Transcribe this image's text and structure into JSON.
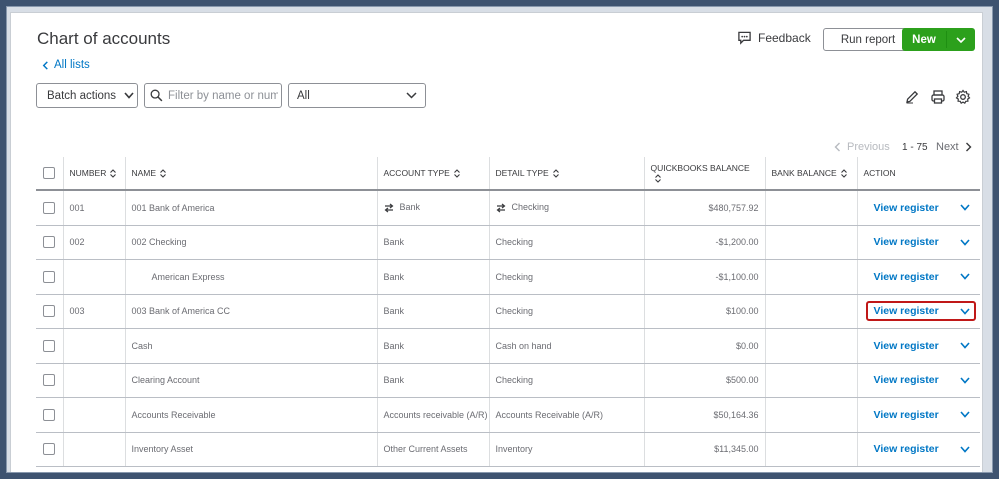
{
  "header": {
    "title": "Chart of accounts",
    "back_link": "All lists",
    "feedback": "Feedback",
    "run_report": "Run report",
    "new_label": "New"
  },
  "toolbar": {
    "batch_actions": "Batch actions",
    "search_placeholder": "Filter by name or number",
    "filter_value": "All"
  },
  "pager": {
    "previous": "Previous",
    "range": "1 - 75",
    "next": "Next"
  },
  "columns": {
    "number": "NUMBER",
    "name": "NAME",
    "account_type": "ACCOUNT TYPE",
    "detail_type": "DETAIL TYPE",
    "qb_balance": "QUICKBOOKS BALANCE",
    "bank_balance": "BANK BALANCE",
    "action": "ACTION"
  },
  "rows": [
    {
      "number": "001",
      "name": "001 Bank of America",
      "account_type": "Bank",
      "detail_type": "Checking",
      "qb_balance": "$480,757.92",
      "bank_balance": "",
      "action": "View register"
    },
    {
      "number": "002",
      "name": "002 Checking",
      "account_type": "Bank",
      "detail_type": "Checking",
      "qb_balance": "-$1,200.00",
      "bank_balance": "",
      "action": "View register"
    },
    {
      "number": "",
      "name": "American Express",
      "account_type": "Bank",
      "detail_type": "Checking",
      "qb_balance": "-$1,100.00",
      "bank_balance": "",
      "action": "View register"
    },
    {
      "number": "003",
      "name": "003 Bank of America CC",
      "account_type": "Bank",
      "detail_type": "Checking",
      "qb_balance": "$100.00",
      "bank_balance": "",
      "action": "View register"
    },
    {
      "number": "",
      "name": "Cash",
      "account_type": "Bank",
      "detail_type": "Cash on hand",
      "qb_balance": "$0.00",
      "bank_balance": "",
      "action": "View register"
    },
    {
      "number": "",
      "name": "Clearing Account",
      "account_type": "Bank",
      "detail_type": "Checking",
      "qb_balance": "$500.00",
      "bank_balance": "",
      "action": "View register"
    },
    {
      "number": "",
      "name": "Accounts Receivable",
      "account_type": "Accounts receivable (A/R)",
      "detail_type": "Accounts Receivable (A/R)",
      "qb_balance": "$50,164.36",
      "bank_balance": "",
      "action": "View register"
    },
    {
      "number": "",
      "name": "Inventory Asset",
      "account_type": "Other Current Assets",
      "detail_type": "Inventory",
      "qb_balance": "$11,345.00",
      "bank_balance": "",
      "action": "View register"
    }
  ],
  "colors": {
    "accent_link": "#0077c5",
    "new_button": "#2ca01c",
    "highlight_border": "#c01818"
  },
  "icons": [
    "chevron-left-icon",
    "feedback-icon",
    "chevron-down-icon",
    "search-icon",
    "pencil-icon",
    "print-icon",
    "gear-icon",
    "sort-icon",
    "transfer-icon"
  ]
}
